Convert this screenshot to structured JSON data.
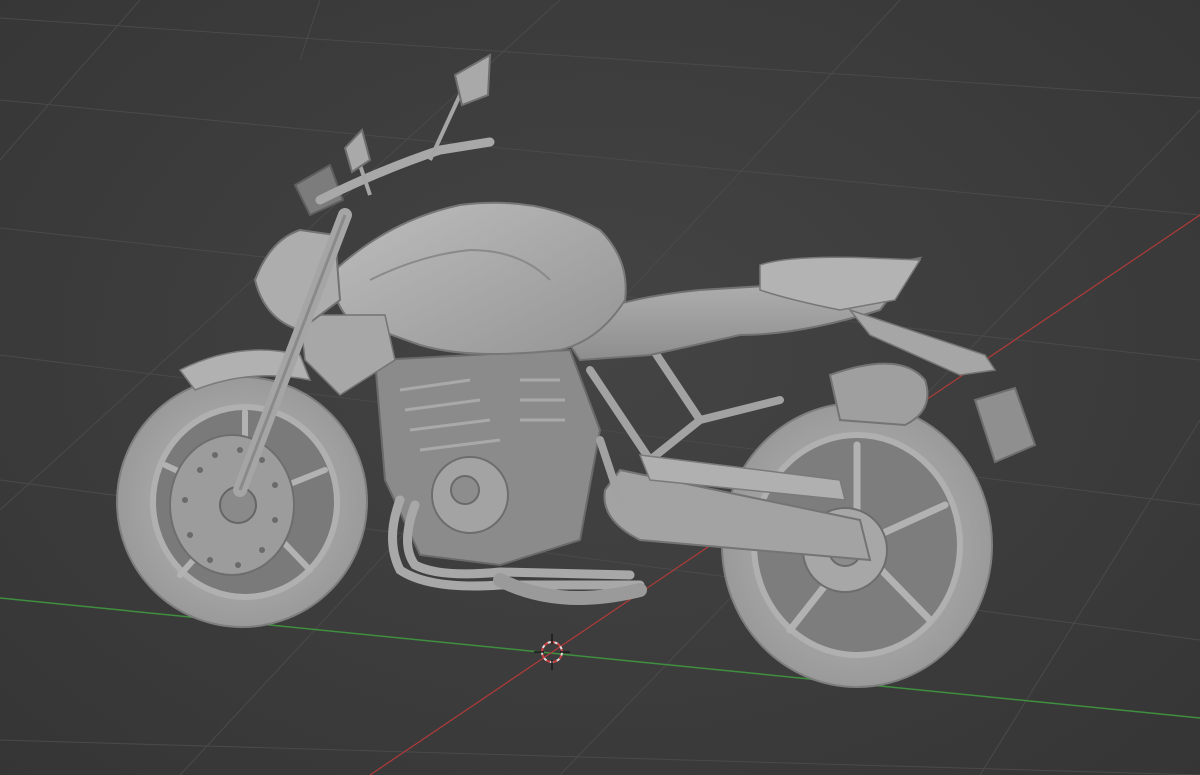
{
  "viewport": {
    "background": "#3c3c3c",
    "grid_color": "#4a4a4a",
    "x_axis_color": "#b03a3a",
    "y_axis_color": "#3f8f3f",
    "model_color": "#a9a9a9"
  },
  "scene": {
    "model_icon": "motorcycle-model",
    "cursor_icon": "3d-cursor-icon"
  }
}
